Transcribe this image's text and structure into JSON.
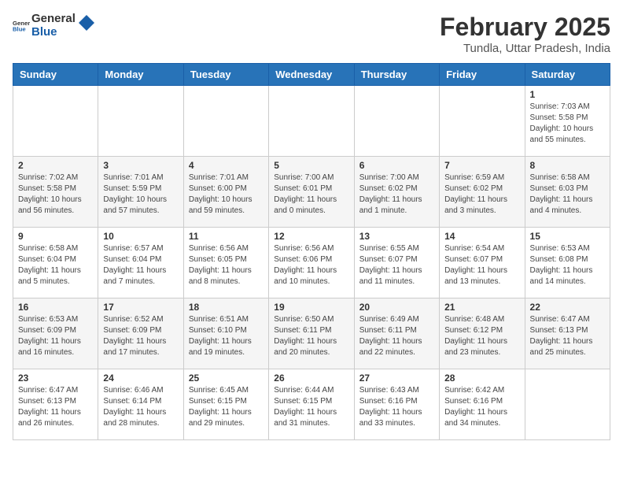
{
  "header": {
    "logo_general": "General",
    "logo_blue": "Blue",
    "month_year": "February 2025",
    "location": "Tundla, Uttar Pradesh, India"
  },
  "weekdays": [
    "Sunday",
    "Monday",
    "Tuesday",
    "Wednesday",
    "Thursday",
    "Friday",
    "Saturday"
  ],
  "weeks": [
    [
      {
        "day": "",
        "info": ""
      },
      {
        "day": "",
        "info": ""
      },
      {
        "day": "",
        "info": ""
      },
      {
        "day": "",
        "info": ""
      },
      {
        "day": "",
        "info": ""
      },
      {
        "day": "",
        "info": ""
      },
      {
        "day": "1",
        "info": "Sunrise: 7:03 AM\nSunset: 5:58 PM\nDaylight: 10 hours\nand 55 minutes."
      }
    ],
    [
      {
        "day": "2",
        "info": "Sunrise: 7:02 AM\nSunset: 5:58 PM\nDaylight: 10 hours\nand 56 minutes."
      },
      {
        "day": "3",
        "info": "Sunrise: 7:01 AM\nSunset: 5:59 PM\nDaylight: 10 hours\nand 57 minutes."
      },
      {
        "day": "4",
        "info": "Sunrise: 7:01 AM\nSunset: 6:00 PM\nDaylight: 10 hours\nand 59 minutes."
      },
      {
        "day": "5",
        "info": "Sunrise: 7:00 AM\nSunset: 6:01 PM\nDaylight: 11 hours\nand 0 minutes."
      },
      {
        "day": "6",
        "info": "Sunrise: 7:00 AM\nSunset: 6:02 PM\nDaylight: 11 hours\nand 1 minute."
      },
      {
        "day": "7",
        "info": "Sunrise: 6:59 AM\nSunset: 6:02 PM\nDaylight: 11 hours\nand 3 minutes."
      },
      {
        "day": "8",
        "info": "Sunrise: 6:58 AM\nSunset: 6:03 PM\nDaylight: 11 hours\nand 4 minutes."
      }
    ],
    [
      {
        "day": "9",
        "info": "Sunrise: 6:58 AM\nSunset: 6:04 PM\nDaylight: 11 hours\nand 5 minutes."
      },
      {
        "day": "10",
        "info": "Sunrise: 6:57 AM\nSunset: 6:04 PM\nDaylight: 11 hours\nand 7 minutes."
      },
      {
        "day": "11",
        "info": "Sunrise: 6:56 AM\nSunset: 6:05 PM\nDaylight: 11 hours\nand 8 minutes."
      },
      {
        "day": "12",
        "info": "Sunrise: 6:56 AM\nSunset: 6:06 PM\nDaylight: 11 hours\nand 10 minutes."
      },
      {
        "day": "13",
        "info": "Sunrise: 6:55 AM\nSunset: 6:07 PM\nDaylight: 11 hours\nand 11 minutes."
      },
      {
        "day": "14",
        "info": "Sunrise: 6:54 AM\nSunset: 6:07 PM\nDaylight: 11 hours\nand 13 minutes."
      },
      {
        "day": "15",
        "info": "Sunrise: 6:53 AM\nSunset: 6:08 PM\nDaylight: 11 hours\nand 14 minutes."
      }
    ],
    [
      {
        "day": "16",
        "info": "Sunrise: 6:53 AM\nSunset: 6:09 PM\nDaylight: 11 hours\nand 16 minutes."
      },
      {
        "day": "17",
        "info": "Sunrise: 6:52 AM\nSunset: 6:09 PM\nDaylight: 11 hours\nand 17 minutes."
      },
      {
        "day": "18",
        "info": "Sunrise: 6:51 AM\nSunset: 6:10 PM\nDaylight: 11 hours\nand 19 minutes."
      },
      {
        "day": "19",
        "info": "Sunrise: 6:50 AM\nSunset: 6:11 PM\nDaylight: 11 hours\nand 20 minutes."
      },
      {
        "day": "20",
        "info": "Sunrise: 6:49 AM\nSunset: 6:11 PM\nDaylight: 11 hours\nand 22 minutes."
      },
      {
        "day": "21",
        "info": "Sunrise: 6:48 AM\nSunset: 6:12 PM\nDaylight: 11 hours\nand 23 minutes."
      },
      {
        "day": "22",
        "info": "Sunrise: 6:47 AM\nSunset: 6:13 PM\nDaylight: 11 hours\nand 25 minutes."
      }
    ],
    [
      {
        "day": "23",
        "info": "Sunrise: 6:47 AM\nSunset: 6:13 PM\nDaylight: 11 hours\nand 26 minutes."
      },
      {
        "day": "24",
        "info": "Sunrise: 6:46 AM\nSunset: 6:14 PM\nDaylight: 11 hours\nand 28 minutes."
      },
      {
        "day": "25",
        "info": "Sunrise: 6:45 AM\nSunset: 6:15 PM\nDaylight: 11 hours\nand 29 minutes."
      },
      {
        "day": "26",
        "info": "Sunrise: 6:44 AM\nSunset: 6:15 PM\nDaylight: 11 hours\nand 31 minutes."
      },
      {
        "day": "27",
        "info": "Sunrise: 6:43 AM\nSunset: 6:16 PM\nDaylight: 11 hours\nand 33 minutes."
      },
      {
        "day": "28",
        "info": "Sunrise: 6:42 AM\nSunset: 6:16 PM\nDaylight: 11 hours\nand 34 minutes."
      },
      {
        "day": "",
        "info": ""
      }
    ]
  ]
}
